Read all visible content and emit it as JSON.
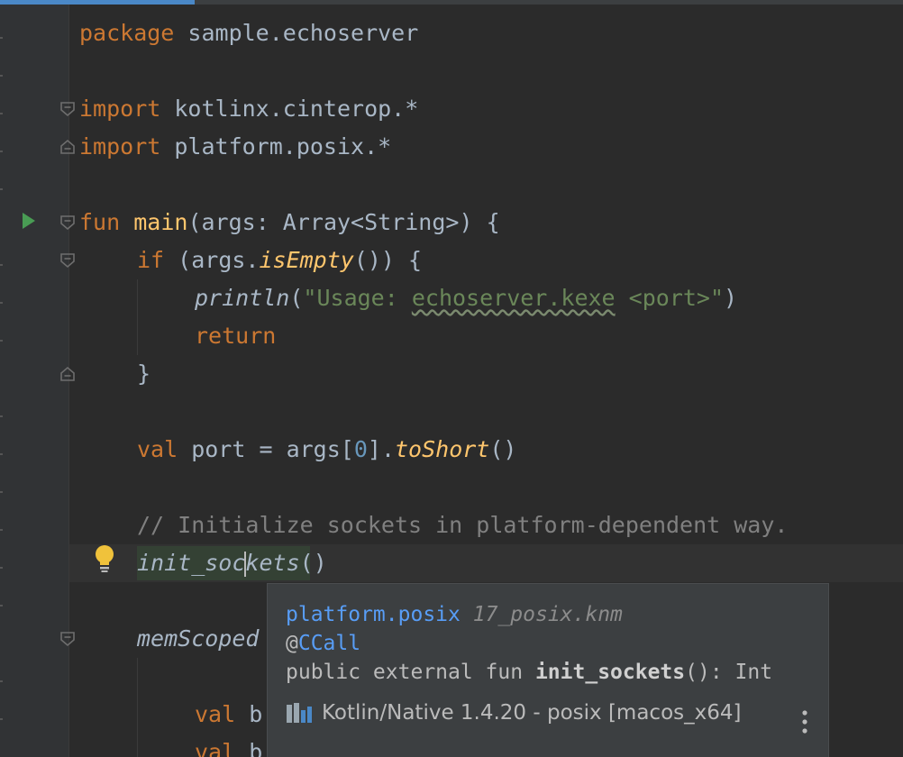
{
  "editor": {
    "lines": {
      "l1": {
        "kw": "package",
        "rest": " sample.echoserver"
      },
      "l2": {
        "kw": "import",
        "rest": " kotlinx.cinterop.*"
      },
      "l3": {
        "kw": "import",
        "rest": " platform.posix.*"
      },
      "l4": {
        "kw": "fun",
        "name": "main",
        "rest": "(args: Array<String>) {"
      },
      "l5": {
        "kw": "if",
        "a": " (args.",
        "ext": "isEmpty",
        "b": "()) {"
      },
      "l6": {
        "fn": "println",
        "a": "(",
        "s1": "\"Usage: ",
        "s2": "echoserver.kexe",
        "s3": " <port>\"",
        "b": ")"
      },
      "l7": {
        "kw": "return"
      },
      "l8": {
        "text": "}"
      },
      "l9": {
        "kw": "val",
        "a": " port = args[",
        "num": "0",
        "b": "].",
        "ext": "toShort",
        "c": "()"
      },
      "l10": {
        "comment": "// Initialize sockets in platform-dependent way."
      },
      "l11": {
        "call_a": "init_soc",
        "call_b": "kets",
        "paren": "()"
      },
      "l12": {
        "call": "memScoped"
      },
      "l13": {
        "kw": "val",
        "rest": " b"
      },
      "l14": {
        "kw": "val",
        "rest": " b"
      }
    }
  },
  "popup": {
    "package": "platform.posix",
    "file": "17_posix.knm",
    "annotation_at": "@",
    "annotation": "CCall",
    "sig_prefix": "public external fun ",
    "sig_name": "init_sockets",
    "sig_suffix": "(): Int",
    "library": "Kotlin/Native 1.4.20 - posix [macos_x64]"
  },
  "colors": {
    "background": "#2b2b2b",
    "keyword": "#cc7832",
    "function": "#ffc66d",
    "string": "#6a8759",
    "number": "#6897bb",
    "comment": "#808080",
    "link": "#589df6",
    "run": "#499c54",
    "bulb": "#f0c23b"
  },
  "icons": {
    "run": "run-gutter-icon",
    "bulb": "intention-bulb-icon",
    "fold": "fold-marker-icon",
    "library": "library-icon",
    "more": "more-vertical-icon"
  }
}
